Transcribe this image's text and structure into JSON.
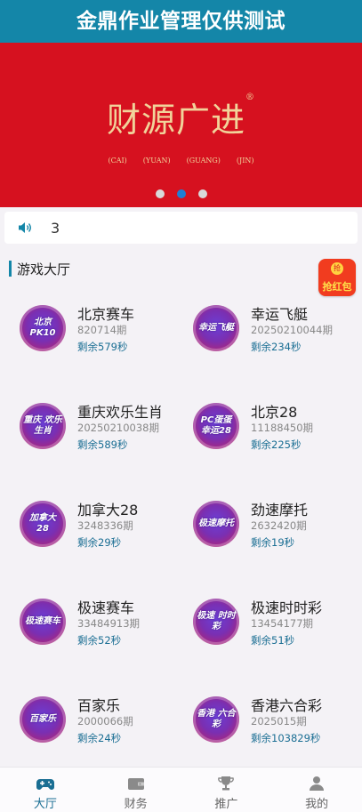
{
  "header": {
    "title": "金鼎作业管理仅供测试"
  },
  "banner": {
    "logo_text": "财源广进",
    "logo_mark": "®",
    "sub_labels": [
      "(CAI)",
      "(YUAN)",
      "(GUANG)",
      "(JIN)"
    ],
    "carousel": {
      "count": 3,
      "active_index": 1
    }
  },
  "notice": {
    "text": "3"
  },
  "lobby": {
    "title": "游戏大厅",
    "redpacket_label": "抢红包",
    "redpacket_coin": "抢"
  },
  "games": [
    {
      "name": "北京赛车",
      "period": "820714期",
      "remain": "剩余579秒",
      "logo": "北京PK10"
    },
    {
      "name": "幸运飞艇",
      "period": "20250210044期",
      "remain": "剩余234秒",
      "logo": "幸运飞艇"
    },
    {
      "name": "重庆欢乐生肖",
      "period": "20250210038期",
      "remain": "剩余589秒",
      "logo": "重庆 欢乐生肖"
    },
    {
      "name": "北京28",
      "period": "11188450期",
      "remain": "剩余225秒",
      "logo": "PC蛋蛋 幸运28"
    },
    {
      "name": "加拿大28",
      "period": "3248336期",
      "remain": "剩余29秒",
      "logo": "加拿大 28"
    },
    {
      "name": "劲速摩托",
      "period": "2632420期",
      "remain": "剩余19秒",
      "logo": "极速摩托"
    },
    {
      "name": "极速赛车",
      "period": "33484913期",
      "remain": "剩余52秒",
      "logo": "极速赛车"
    },
    {
      "name": "极速时时彩",
      "period": "13454177期",
      "remain": "剩余51秒",
      "logo": "极速 时时彩"
    },
    {
      "name": "百家乐",
      "period": "2000066期",
      "remain": "剩余24秒",
      "logo": "百家乐"
    },
    {
      "name": "香港六合彩",
      "period": "2025015期",
      "remain": "剩余103829秒",
      "logo": "香港 六合彩"
    }
  ],
  "tabbar": [
    {
      "label": "大厅",
      "icon": "gamepad-icon",
      "active": true
    },
    {
      "label": "财务",
      "icon": "wallet-icon",
      "active": false
    },
    {
      "label": "推广",
      "icon": "trophy-icon",
      "active": false
    },
    {
      "label": "我的",
      "icon": "user-icon",
      "active": false
    }
  ],
  "colors": {
    "header": "#1486a8",
    "banner": "#d6111f",
    "accent": "#1a6e93",
    "carousel_active": "#1f7fd4"
  }
}
